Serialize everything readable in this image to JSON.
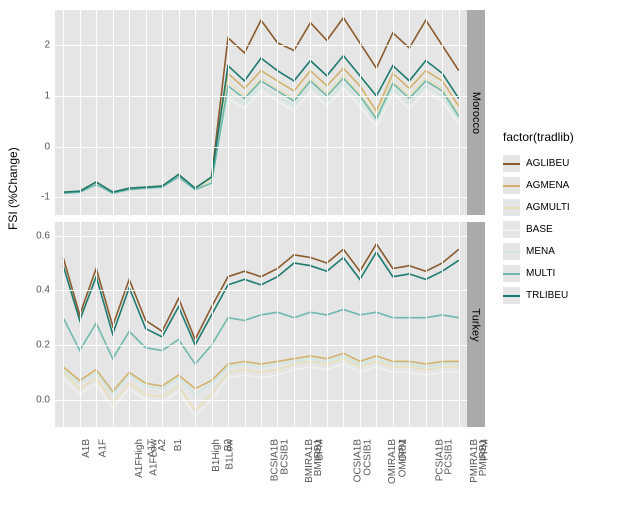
{
  "y_axis_title": "FSI (%Change)",
  "legend_title": "factor(tradlib)",
  "facets": [
    {
      "label": "Morocco"
    },
    {
      "label": "Turkey"
    }
  ],
  "categories": [
    "A1B",
    "A1F",
    "A1FHigh",
    "A1FLow",
    "A1T",
    "A2",
    "B1",
    "B1High",
    "B1Low",
    "B2",
    "BCSIA1B",
    "BCSIB1",
    "BMIRA1B",
    "BMIRB1",
    "BPM",
    "OCSIA1B",
    "OCSIB1",
    "OMIRA1B",
    "OMIRB1",
    "OPM",
    "PCSIA1B",
    "PCSIB1",
    "PMIRA1B",
    "PMIRB1",
    "PPM"
  ],
  "y_ticks_top": [
    "-1",
    "0",
    "1",
    "2"
  ],
  "y_ticks_bottom": [
    "0.0",
    "0.2",
    "0.4",
    "0.6"
  ],
  "y_range_top": [
    -1.35,
    2.7
  ],
  "y_range_bottom": [
    -0.1,
    0.65
  ],
  "series": [
    {
      "name": "AGLIBEU",
      "color": "#8b5a2b"
    },
    {
      "name": "AGMENA",
      "color": "#d4b16a"
    },
    {
      "name": "AGMULTI",
      "color": "#e8dfb8"
    },
    {
      "name": "BASE",
      "color": "#f0f0ee"
    },
    {
      "name": "MENA",
      "color": "#cde6df"
    },
    {
      "name": "MULTI",
      "color": "#6eb8ad"
    },
    {
      "name": "TRLIBEU",
      "color": "#1c7a6f"
    }
  ],
  "chart_data": [
    {
      "facet": "Morocco",
      "type": "line",
      "xlabel": "",
      "ylabel": "FSI (%Change)",
      "ylim": [
        -1.35,
        2.7
      ],
      "categories": [
        "A1B",
        "A1F",
        "A1FHigh",
        "A1FLow",
        "A1T",
        "A2",
        "B1",
        "B1High",
        "B1Low",
        "B2",
        "BCSIA1B",
        "BCSIB1",
        "BMIRA1B",
        "BMIRB1",
        "BPM",
        "OCSIA1B",
        "OCSIB1",
        "OMIRA1B",
        "OMIRB1",
        "OPM",
        "PCSIA1B",
        "PCSIB1",
        "PMIRA1B",
        "PMIRB1",
        "PPM"
      ],
      "series": [
        {
          "name": "AGLIBEU",
          "values": [
            -0.9,
            -0.88,
            -0.7,
            -0.9,
            -0.82,
            -0.8,
            -0.78,
            -0.55,
            -0.82,
            -0.6,
            2.15,
            1.85,
            2.5,
            2.05,
            1.9,
            2.45,
            2.1,
            2.55,
            2.05,
            1.55,
            2.25,
            1.95,
            2.5,
            2.0,
            1.5
          ]
        },
        {
          "name": "AGMENA",
          "values": [
            -0.9,
            -0.88,
            -0.72,
            -0.9,
            -0.82,
            -0.8,
            -0.78,
            -0.57,
            -0.82,
            -0.65,
            1.45,
            1.15,
            1.5,
            1.3,
            1.1,
            1.5,
            1.2,
            1.55,
            1.2,
            0.7,
            1.45,
            1.15,
            1.5,
            1.3,
            0.8
          ]
        },
        {
          "name": "AGMULTI",
          "values": [
            -0.9,
            -0.88,
            -0.72,
            -0.9,
            -0.82,
            -0.8,
            -0.78,
            -0.57,
            -0.82,
            -0.65,
            1.3,
            1.0,
            1.35,
            1.15,
            0.95,
            1.35,
            1.05,
            1.4,
            1.05,
            0.6,
            1.3,
            1.0,
            1.35,
            1.15,
            0.65
          ]
        },
        {
          "name": "BASE",
          "values": [
            -0.92,
            -0.9,
            -0.75,
            -0.92,
            -0.85,
            -0.82,
            -0.8,
            -0.6,
            -0.85,
            -0.72,
            0.95,
            0.75,
            1.1,
            0.9,
            0.7,
            1.1,
            0.8,
            1.15,
            0.8,
            0.4,
            1.05,
            0.75,
            1.1,
            0.9,
            0.45
          ]
        },
        {
          "name": "MENA",
          "values": [
            -0.92,
            -0.9,
            -0.75,
            -0.92,
            -0.85,
            -0.82,
            -0.8,
            -0.6,
            -0.85,
            -0.72,
            1.05,
            0.85,
            1.2,
            1.0,
            0.8,
            1.2,
            0.9,
            1.25,
            0.9,
            0.5,
            1.15,
            0.85,
            1.2,
            1.0,
            0.55
          ]
        },
        {
          "name": "MULTI",
          "values": [
            -0.92,
            -0.9,
            -0.75,
            -0.92,
            -0.85,
            -0.82,
            -0.8,
            -0.6,
            -0.85,
            -0.72,
            1.2,
            0.95,
            1.3,
            1.1,
            0.9,
            1.3,
            1.0,
            1.35,
            1.0,
            0.55,
            1.25,
            0.95,
            1.3,
            1.1,
            0.6
          ]
        },
        {
          "name": "TRLIBEU",
          "values": [
            -0.9,
            -0.88,
            -0.7,
            -0.9,
            -0.82,
            -0.8,
            -0.78,
            -0.55,
            -0.82,
            -0.6,
            1.6,
            1.3,
            1.75,
            1.5,
            1.3,
            1.7,
            1.4,
            1.8,
            1.4,
            1.0,
            1.6,
            1.3,
            1.7,
            1.45,
            0.95
          ]
        }
      ]
    },
    {
      "facet": "Turkey",
      "type": "line",
      "xlabel": "",
      "ylabel": "FSI (%Change)",
      "ylim": [
        -0.1,
        0.65
      ],
      "categories": [
        "A1B",
        "A1F",
        "A1FHigh",
        "A1FLow",
        "A1T",
        "A2",
        "B1",
        "B1High",
        "B1Low",
        "B2",
        "BCSIA1B",
        "BCSIB1",
        "BMIRA1B",
        "BMIRB1",
        "BPM",
        "OCSIA1B",
        "OCSIB1",
        "OMIRA1B",
        "OMIRB1",
        "OPM",
        "PCSIA1B",
        "PCSIB1",
        "PMIRA1B",
        "PMIRB1",
        "PPM"
      ],
      "series": [
        {
          "name": "AGLIBEU",
          "values": [
            0.52,
            0.31,
            0.48,
            0.27,
            0.44,
            0.29,
            0.25,
            0.37,
            0.22,
            0.34,
            0.45,
            0.47,
            0.45,
            0.48,
            0.53,
            0.52,
            0.5,
            0.55,
            0.47,
            0.57,
            0.48,
            0.49,
            0.47,
            0.5,
            0.55
          ]
        },
        {
          "name": "AGMENA",
          "values": [
            0.12,
            0.07,
            0.11,
            0.03,
            0.1,
            0.06,
            0.05,
            0.09,
            0.04,
            0.07,
            0.13,
            0.14,
            0.13,
            0.14,
            0.15,
            0.16,
            0.15,
            0.17,
            0.14,
            0.16,
            0.14,
            0.14,
            0.13,
            0.14,
            0.14
          ]
        },
        {
          "name": "AGMULTI",
          "values": [
            0.1,
            0.04,
            0.08,
            -0.01,
            0.06,
            0.02,
            0.01,
            0.05,
            -0.04,
            0.02,
            0.1,
            0.11,
            0.1,
            0.11,
            0.13,
            0.14,
            0.13,
            0.15,
            0.12,
            0.14,
            0.12,
            0.12,
            0.11,
            0.12,
            0.12
          ]
        },
        {
          "name": "BASE",
          "values": [
            0.08,
            0.02,
            0.06,
            -0.03,
            0.04,
            0.0,
            -0.01,
            0.03,
            -0.06,
            0.0,
            0.08,
            0.09,
            0.08,
            0.09,
            0.11,
            0.12,
            0.11,
            0.13,
            0.1,
            0.12,
            0.1,
            0.1,
            0.09,
            0.1,
            0.1
          ]
        },
        {
          "name": "MENA",
          "values": [
            0.11,
            0.06,
            0.1,
            0.02,
            0.09,
            0.05,
            0.04,
            0.08,
            0.02,
            0.06,
            0.12,
            0.13,
            0.12,
            0.13,
            0.14,
            0.15,
            0.14,
            0.16,
            0.13,
            0.15,
            0.13,
            0.13,
            0.12,
            0.13,
            0.13
          ]
        },
        {
          "name": "MULTI",
          "values": [
            0.3,
            0.18,
            0.28,
            0.15,
            0.25,
            0.19,
            0.18,
            0.22,
            0.13,
            0.2,
            0.3,
            0.29,
            0.31,
            0.32,
            0.3,
            0.32,
            0.31,
            0.33,
            0.31,
            0.32,
            0.3,
            0.3,
            0.3,
            0.31,
            0.3
          ]
        },
        {
          "name": "TRLIBEU",
          "values": [
            0.49,
            0.29,
            0.45,
            0.24,
            0.41,
            0.26,
            0.23,
            0.34,
            0.2,
            0.31,
            0.42,
            0.44,
            0.42,
            0.45,
            0.5,
            0.49,
            0.47,
            0.52,
            0.44,
            0.54,
            0.45,
            0.46,
            0.44,
            0.47,
            0.51
          ]
        }
      ]
    }
  ]
}
